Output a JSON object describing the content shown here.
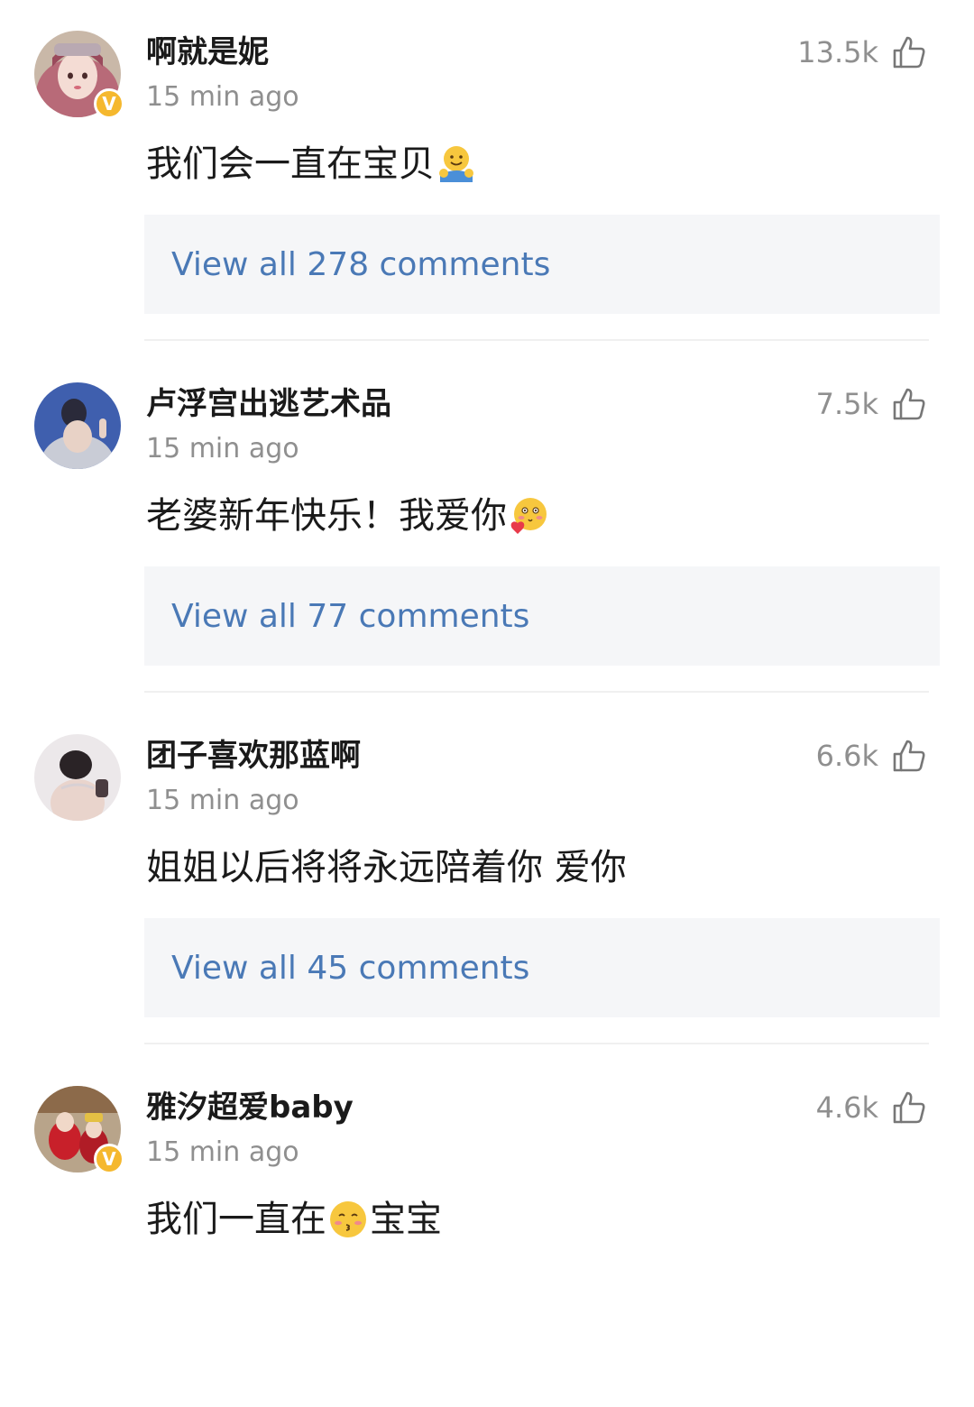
{
  "comments": [
    {
      "username": "啊就是妮",
      "time": "15 min ago",
      "likes": "13.5k",
      "text_before": "我们会一直在宝贝",
      "emoji": "hug-emoji",
      "text_after": "",
      "replies": "View all 278 comments",
      "verified": true,
      "verified_mark": "V",
      "avatar": "pink-hair-avatar"
    },
    {
      "username": "卢浮宫出逃艺术品",
      "time": "15 min ago",
      "likes": "7.5k",
      "text_before": "老婆新年快乐！我爱你",
      "emoji": "blushing-heart-emoji",
      "text_after": "",
      "replies": "View all 77 comments",
      "verified": false,
      "avatar": "blue-dress-avatar"
    },
    {
      "username": "团子喜欢那蓝啊",
      "time": "15 min ago",
      "likes": "6.6k",
      "text_before": "姐姐以后将将永远陪着你 爱你",
      "emoji": "",
      "text_after": "",
      "replies": "View all 45 comments",
      "verified": false,
      "avatar": "back-view-avatar"
    },
    {
      "username": "雅汐超爱baby",
      "time": "15 min ago",
      "likes": "4.6k",
      "text_before": "我们一直在",
      "emoji": "kissing-emoji",
      "text_after": "宝宝",
      "replies": "",
      "verified": true,
      "verified_mark": "V",
      "avatar": "red-costume-avatar"
    }
  ],
  "colors": {
    "link": "#4a79b6",
    "muted": "#8f8f8f",
    "reply_bg": "#f5f6f8",
    "verified": "#f5b82e"
  },
  "icons": {
    "like": "thumbs-up-outline-icon"
  }
}
